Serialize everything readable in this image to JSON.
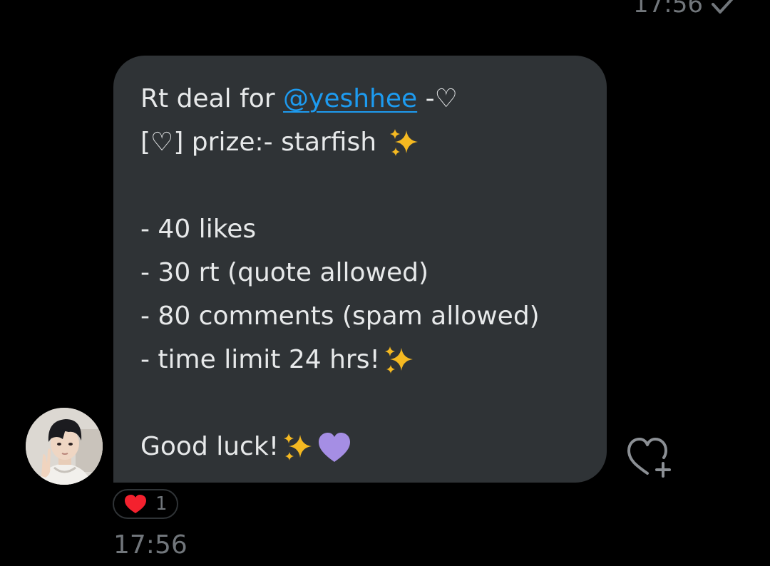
{
  "header": {
    "sent_time": "17:56",
    "sent_status_icon": "check-icon"
  },
  "message": {
    "line1_text": "Rt deal for ",
    "mention": "@yeshhee",
    "line1_suffix": " -♡",
    "line2_text": "[♡] prize:- starfish ",
    "line3_text": "- 40 likes",
    "line4_text": "- 30 rt (quote allowed)",
    "line5_text": "- 80 comments (spam allowed)",
    "line6_text": "- time limit 24 hrs!",
    "line7_text": "Good luck!",
    "emojis": [
      "sparkles-emoji",
      "purple-heart-emoji"
    ]
  },
  "reaction": {
    "icon": "red-heart-icon",
    "count": "1"
  },
  "received_time": "17:56",
  "colors": {
    "background": "#000000",
    "bubble": "#2f3336",
    "mention": "#1d9bf0",
    "muted": "#71767b",
    "sparkle": "#f5b921",
    "purple_heart": "#a58ee4",
    "red_heart": "#f4212e"
  }
}
